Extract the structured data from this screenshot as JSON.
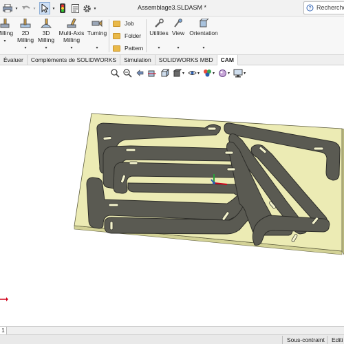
{
  "window": {
    "title": "Assemblage3.SLDASM *",
    "search_placeholder": "Recherche"
  },
  "ribbon": {
    "commands": [
      {
        "label_line1": "",
        "label_line2": "Milling"
      },
      {
        "label_line1": "2D",
        "label_line2": "Milling"
      },
      {
        "label_line1": "3D",
        "label_line2": "Milling"
      },
      {
        "label_line1": "Multi-Axis",
        "label_line2": "Milling"
      },
      {
        "label_line1": "Turning",
        "label_line2": ""
      }
    ],
    "small_commands": [
      "Job",
      "Folder",
      "Pattern"
    ],
    "right_commands": [
      "Utilities",
      "View",
      "Orientation"
    ]
  },
  "tabs": [
    {
      "label": "Évaluer",
      "active": false
    },
    {
      "label": "Compléments de SOLIDWORKS",
      "active": false
    },
    {
      "label": "Simulation",
      "active": false
    },
    {
      "label": "SOLIDWORKS MBD",
      "active": false
    },
    {
      "label": "CAM",
      "active": true
    }
  ],
  "sheet": {
    "tab_label": "1"
  },
  "status": {
    "constraint": "Sous-contraint",
    "mode": "Editi"
  },
  "colors": {
    "plate": "#ecebb4",
    "plate_side": "#d3d296",
    "part": "#5a5a52",
    "part_edge": "#2e2e2a",
    "accent": "#2a5db0",
    "stop_red": "#d0021b"
  }
}
